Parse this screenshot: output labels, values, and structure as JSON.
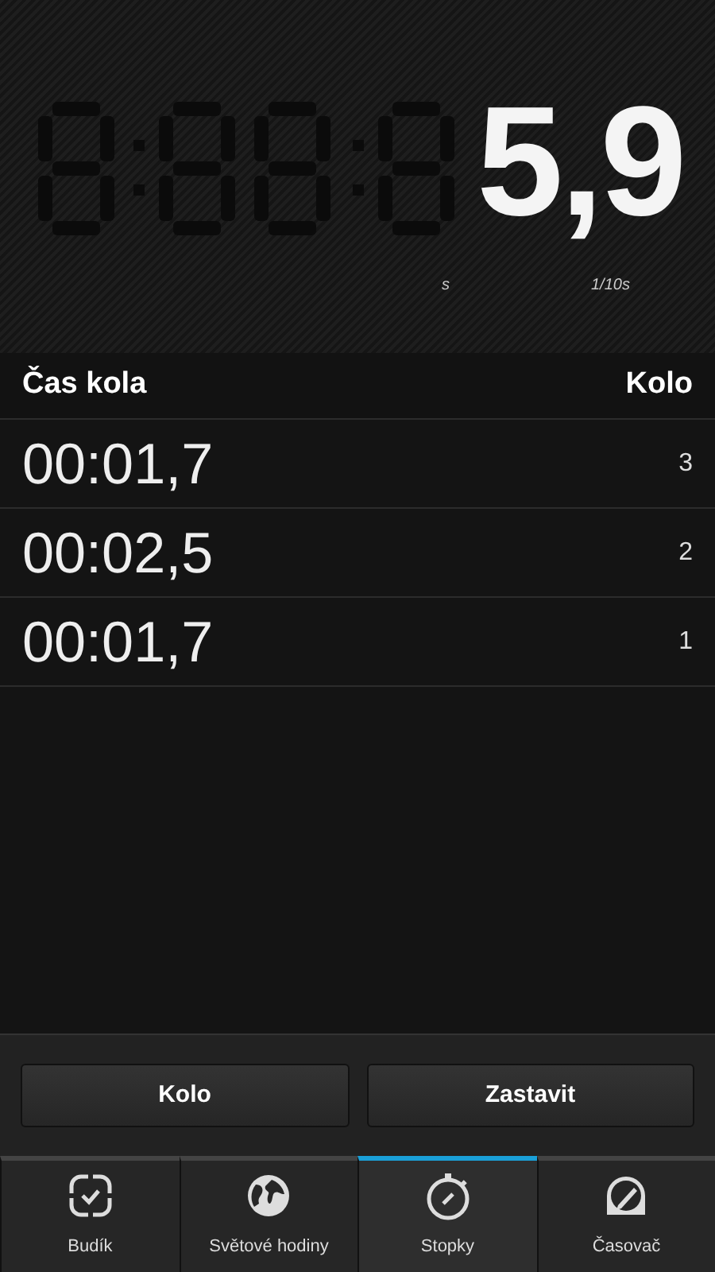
{
  "display": {
    "value": "5,9",
    "unit_seconds": "s",
    "unit_tenths": "1/10s"
  },
  "laps": {
    "columns": [
      "Čas kola",
      "Kolo"
    ],
    "rows": [
      {
        "time": "00:01,7",
        "lap": "3"
      },
      {
        "time": "00:02,5",
        "lap": "2"
      },
      {
        "time": "00:01,7",
        "lap": "1"
      }
    ]
  },
  "buttons": [
    "Kolo",
    "Zastavit"
  ],
  "tabs": [
    {
      "label": "Budík",
      "selected": false
    },
    {
      "label": "Světové hodiny",
      "selected": false
    },
    {
      "label": "Stopky",
      "selected": true
    },
    {
      "label": "Časovač",
      "selected": false
    }
  ]
}
